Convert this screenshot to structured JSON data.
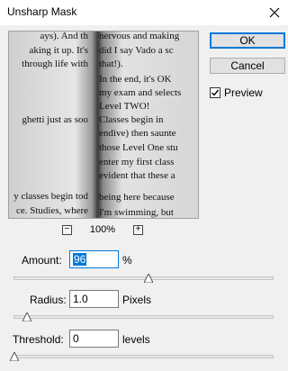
{
  "window": {
    "title": "Unsharp Mask"
  },
  "buttons": {
    "ok": "OK",
    "cancel": "Cancel"
  },
  "preview_checkbox": {
    "label": "Preview",
    "checked": true
  },
  "zoom": {
    "level": "100%",
    "minus": "−",
    "plus": "+"
  },
  "amount": {
    "label": "Amount:",
    "value": "96",
    "unit": "%",
    "slider_fraction": 0.52
  },
  "radius": {
    "label": "Radius:",
    "value": "1.0",
    "unit": "Pixels",
    "slider_fraction": 0.05
  },
  "threshold": {
    "label": "Threshold:",
    "value": "0",
    "unit": "levels",
    "slider_fraction": 0.0
  },
  "book_text": {
    "left": [
      "ays). And th",
      "aking it up. It's",
      "through life with",
      "ghetti just as soo",
      "y classes begin tod",
      "ce. Studies, where"
    ],
    "right": [
      "nervous and making",
      "did I say Vado a sc",
      "that!).",
      "In the end, it's OK",
      "my exam and selects",
      "Level TWO!",
      "Classes begin in",
      "endive) then saunte",
      "those Level One stu",
      "enter my first class",
      "evident that these a",
      "being here because",
      "I'm swimming, but"
    ]
  }
}
